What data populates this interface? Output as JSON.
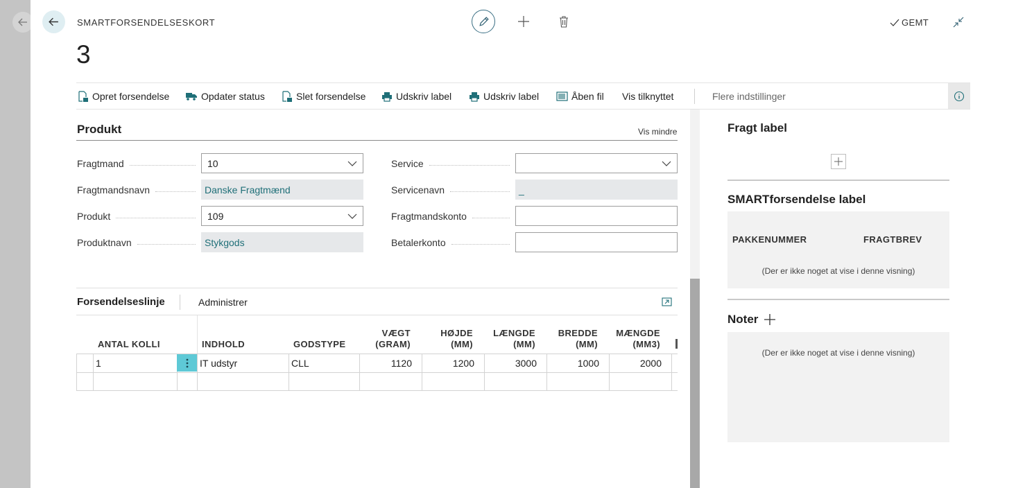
{
  "colors": {
    "accent": "#5ec9d6",
    "link": "#1f6f78",
    "readonly_bg": "#e6e8ea",
    "edit_ring": "#3a6f84"
  },
  "header": {
    "kicker": "SMARTFORSENDELSESKORT",
    "title": "3",
    "saved_label": "GEMT",
    "icons": [
      "back-arrow-icon",
      "pencil-icon",
      "plus-icon",
      "trash-icon",
      "check-icon",
      "collapse-icon"
    ]
  },
  "actions": {
    "items": [
      {
        "label": "Opret forsendelse",
        "icon": "document-shipment-icon"
      },
      {
        "label": "Opdater status",
        "icon": "truck-refresh-icon"
      },
      {
        "label": "Slet forsendelse",
        "icon": "document-delete-icon"
      },
      {
        "label": "Udskriv label",
        "icon": "printer-icon"
      },
      {
        "label": "Udskriv label",
        "icon": "printer-icon"
      },
      {
        "label": "Åben fil",
        "icon": "barcode-icon"
      },
      {
        "label": "Vis tilknyttet"
      }
    ],
    "more": "Flere indstillinger",
    "info_icon": "info-icon"
  },
  "produkt": {
    "title": "Produkt",
    "toggle": "Vis mindre",
    "left": [
      {
        "label": "Fragtmand",
        "value": "10",
        "kind": "select"
      },
      {
        "label": "Fragtmandsnavn",
        "value": "Danske Fragtmænd",
        "kind": "readonly"
      },
      {
        "label": "Produkt",
        "value": "109",
        "kind": "select"
      },
      {
        "label": "Produktnavn",
        "value": "Stykgods",
        "kind": "readonly"
      }
    ],
    "right": [
      {
        "label": "Service",
        "value": "",
        "kind": "select"
      },
      {
        "label": "Servicenavn",
        "value": "_",
        "kind": "readonly"
      },
      {
        "label": "Fragtmandskonto",
        "value": "",
        "kind": "input"
      },
      {
        "label": "Betalerkonto",
        "value": "",
        "kind": "input"
      }
    ]
  },
  "lines": {
    "title": "Forsendelseslinje",
    "tab": "Administrer",
    "expand_icon": "expand-icon",
    "columns": {
      "antal": "ANTAL KOLLI",
      "indhold": "INDHOLD",
      "godstype": "GODSTYPE",
      "vaegt": [
        "VÆGT",
        "(GRAM)"
      ],
      "hojde": [
        "HØJDE",
        "(MM)"
      ],
      "laengde": [
        "LÆNGDE",
        "(MM)"
      ],
      "bredde": [
        "BREDDE",
        "(MM)"
      ],
      "maengde": [
        "MÆNGDE",
        "(MM3)"
      ]
    },
    "rows": [
      {
        "antal": "1",
        "indhold": "IT udstyr",
        "godstype": "CLL",
        "vaegt": "1120",
        "hojde": "1200",
        "laengde": "3000",
        "bredde": "1000",
        "maengde": "2000"
      }
    ]
  },
  "side": {
    "fragt_label": "Fragt label",
    "smart_label": "SMARTforsendelse label",
    "smart_cols": [
      "PAKKENUMMER",
      "FRAGTBREV"
    ],
    "empty": "(Der er ikke noget at vise i denne visning)",
    "noter": "Noter"
  }
}
